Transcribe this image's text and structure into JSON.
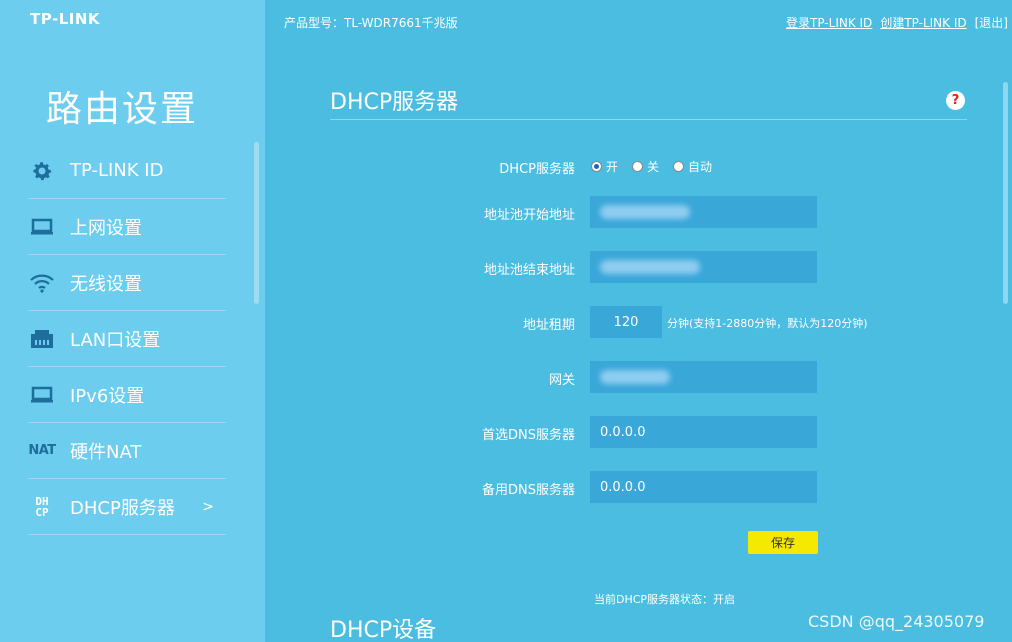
{
  "brand": {
    "logo": "TP-LINK"
  },
  "header": {
    "model": "产品型号：TL-WDR7661千兆版",
    "login_link": "登录TP-LINK ID",
    "create_link": "创建TP-LINK ID",
    "logout": "[退出]"
  },
  "sidebar": {
    "title": "路由设置",
    "items": [
      {
        "label": "TP-LINK ID",
        "icon": "gear-icon"
      },
      {
        "label": "上网设置",
        "icon": "laptop-icon"
      },
      {
        "label": "无线设置",
        "icon": "wifi-icon"
      },
      {
        "label": "LAN口设置",
        "icon": "lan-port-icon"
      },
      {
        "label": "IPv6设置",
        "icon": "laptop-icon"
      },
      {
        "label": "硬件NAT",
        "icon": "nat-icon",
        "icon_text": "NAT"
      },
      {
        "label": "DHCP服务器",
        "icon": "dhcp-icon",
        "icon_text_top": "DH",
        "icon_text_bottom": "CP",
        "active": true,
        "arrow": ">"
      }
    ]
  },
  "main": {
    "section_title": "DHCP服务器",
    "help": "?",
    "form": {
      "dhcp_label": "DHCP服务器",
      "radio_options": [
        "开",
        "关",
        "自动"
      ],
      "radio_selected": "开",
      "pool_start_label": "地址池开始地址",
      "pool_end_label": "地址池结束地址",
      "lease_label": "地址租期",
      "lease_value": "120",
      "lease_hint": "分钟(支持1-2880分钟，默认为120分钟)",
      "gateway_label": "网关",
      "dns1_label": "首选DNS服务器",
      "dns1_value": "0.0.0.0",
      "dns2_label": "备用DNS服务器",
      "dns2_value": "0.0.0.0"
    },
    "save_label": "保存",
    "status_text": "当前DHCP服务器状态：开启",
    "next_section_title": "DHCP设备"
  },
  "watermark": "CSDN @qq_24305079",
  "colors": {
    "sidebar_bg": "#6dcdee",
    "main_bg": "#4bbde0",
    "field_bg": "#3aa7d9",
    "save_button": "#f6e900"
  }
}
